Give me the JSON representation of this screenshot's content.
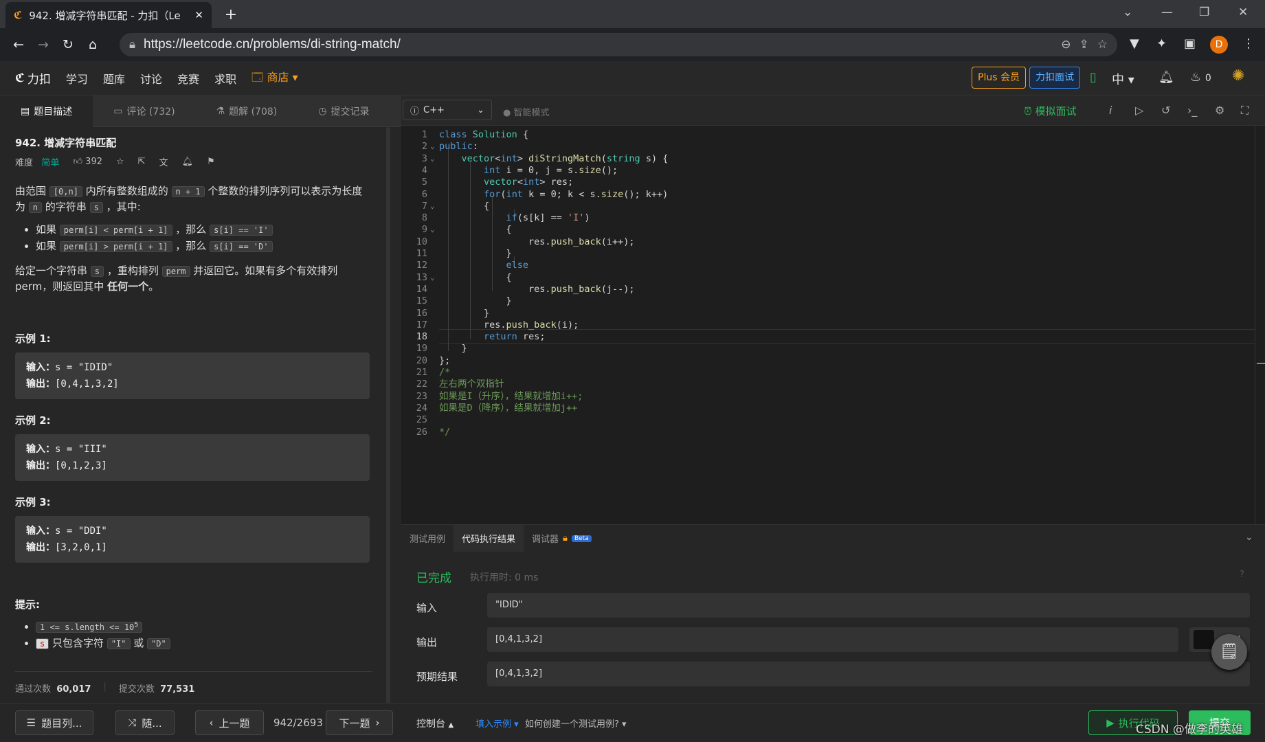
{
  "browser": {
    "tab_title": "942. 增减字符串匹配 - 力扣（Le",
    "url": "https://leetcode.cn/problems/di-string-match/",
    "profile_initial": "D"
  },
  "nav": {
    "logo": "力扣",
    "items": [
      "学习",
      "题库",
      "讨论",
      "竞赛",
      "求职"
    ],
    "shop": "商店",
    "plus": "Plus 会员",
    "interview": "力扣面试",
    "lang": "中",
    "points": "0"
  },
  "left": {
    "tabs": [
      "题目描述",
      "评论 (732)",
      "题解 (708)",
      "提交记录"
    ],
    "title": "942. 增减字符串匹配",
    "difficulty_label": "难度",
    "difficulty": "简单",
    "likes": "392",
    "p1_a": "由范围",
    "p1_c1": "[0,n]",
    "p1_b": "内所有整数组成的",
    "p1_c2": "n + 1",
    "p1_c": "个整数的排列序列可以表示为长度为",
    "p1_c3": "n",
    "p1_d": "的字符串",
    "p1_c4": "s",
    "p1_e": "，其中:",
    "b1_a": "如果",
    "b1_c1": "perm[i] < perm[i + 1]",
    "b1_b": "，那么",
    "b1_c2": "s[i] == 'I'",
    "b2_a": "如果",
    "b2_c1": "perm[i] > perm[i + 1]",
    "b2_b": "，那么",
    "b2_c2": "s[i] == 'D'",
    "p2_a": "给定一个字符串",
    "p2_c1": "s",
    "p2_b": "，重构排列",
    "p2_c2": "perm",
    "p2_c": "并返回它。如果有多个有效排列perm，则返回其中",
    "p2_bold": "任何一个",
    "p2_d": "。",
    "examples": [
      {
        "h": "示例 1:",
        "in_label": "输入：",
        "in": "s = \"IDID\"",
        "out_label": "输出：",
        "out": "[0,4,1,3,2]"
      },
      {
        "h": "示例 2:",
        "in_label": "输入：",
        "in": "s = \"III\"",
        "out_label": "输出：",
        "out": "[0,1,2,3]"
      },
      {
        "h": "示例 3:",
        "in_label": "输入：",
        "in": "s = \"DDI\"",
        "out_label": "输出：",
        "out": "[3,2,0,1]"
      }
    ],
    "hint_h": "提示:",
    "hint1": "1 <= s.length <= 10",
    "hint1_sup": "5",
    "hint2_c1": "s",
    "hint2_a": "只包含字符",
    "hint2_c2": "\"I\"",
    "hint2_b": "或",
    "hint2_c3": "\"D\"",
    "passed_label": "通过次数",
    "passed": "60,017",
    "submitted_label": "提交次数",
    "submitted": "77,531",
    "btn_list": "题目列...",
    "btn_random": "随...",
    "btn_prev": "上一题",
    "page": "942/2693",
    "btn_next": "下一题"
  },
  "editor": {
    "language": "C++",
    "smart": "智能模式",
    "mock": "模拟面试",
    "current_line": 18
  },
  "console": {
    "tabs": [
      "测试用例",
      "代码执行结果",
      "调试器"
    ],
    "beta": "Beta",
    "status": "已完成",
    "time": "执行用时: 0 ms",
    "input_label": "输入",
    "input": "\"IDID\"",
    "output_label": "输出",
    "output": "[0,4,1,3,2]",
    "expected_label": "预期结果",
    "expected": "[0,4,1,3,2]",
    "diff": "差别",
    "console_btn": "控制台",
    "fill": "填入示例",
    "howto": "如何创建一个测试用例?",
    "run": "执行代码",
    "submit": "提交"
  },
  "watermark": "CSDN @做李的英雄",
  "colors": {
    "accent": "#ffa116",
    "success": "#2cbb5d",
    "easy": "#00af9b",
    "link": "#2e8bff"
  }
}
